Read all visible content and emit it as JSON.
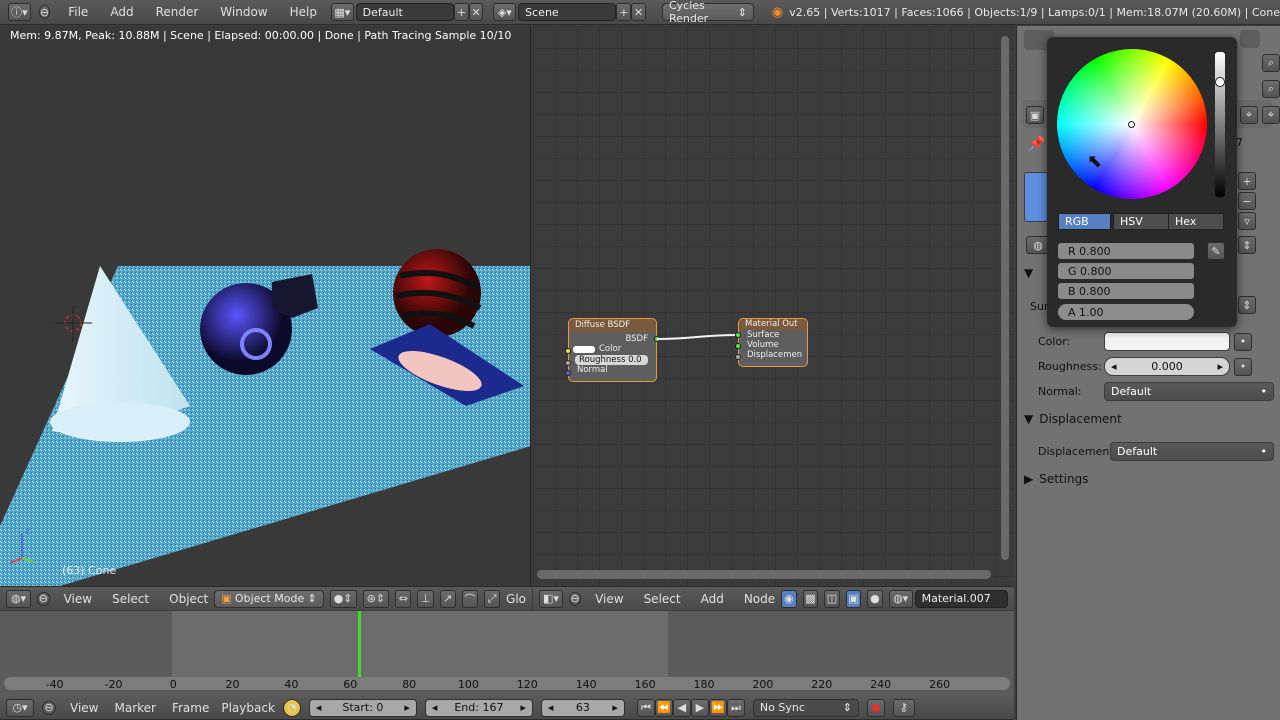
{
  "topbar": {
    "menus": [
      "File",
      "Add",
      "Render",
      "Window",
      "Help"
    ],
    "layout": "Default",
    "scene": "Scene",
    "engine": "Cycles Render",
    "stats": "v2.65 | Verts:1017 | Faces:1066 | Objects:1/9 | Lamps:0/1 | Mem:18.07M (20.60M) | Cone"
  },
  "viewport": {
    "info": "Mem: 9.87M, Peak: 10.88M | Scene | Elapsed: 00:00.00 | Done | Path Tracing Sample 10/10",
    "object_label": "(63) Cone",
    "header": {
      "view": "View",
      "select": "Select",
      "object": "Object",
      "mode": "Object Mode",
      "global": "Glo"
    }
  },
  "node_editor": {
    "diffuse": {
      "title": "Diffuse BSDF",
      "out": "BSDF",
      "color": "Color",
      "roughness": "Roughness 0.0",
      "normal": "Normal"
    },
    "output": {
      "title": "Material Out",
      "surface": "Surface",
      "volume": "Volume",
      "displacement": "Displacemen"
    },
    "header": {
      "view": "View",
      "select": "Select",
      "add": "Add",
      "node": "Node",
      "material": "Material.007"
    }
  },
  "properties": {
    "surface_label": "Surf",
    "color_label": "Color:",
    "roughness_label": "Roughness:",
    "roughness_value": "0.000",
    "normal_label": "Normal:",
    "normal_value": "Default",
    "displacement_section": "Displacement",
    "displacement_label": "Displacement:",
    "displacement_value": "Default",
    "settings_section": "Settings",
    "partial_7": "7"
  },
  "picker": {
    "tabs": [
      "RGB",
      "HSV",
      "Hex"
    ],
    "active_tab": "RGB",
    "r": "R 0.800",
    "g": "G 0.800",
    "b": "B 0.800",
    "a": "A 1.00",
    "value_fraction": 0.8
  },
  "timeline": {
    "ticks": [
      "-40",
      "-20",
      "0",
      "20",
      "40",
      "60",
      "80",
      "100",
      "120",
      "140",
      "160",
      "180",
      "200",
      "220",
      "240",
      "260"
    ],
    "current_frame": 63
  },
  "bottombar": {
    "view": "View",
    "marker": "Marker",
    "frame": "Frame",
    "playback": "Playback",
    "start": "Start: 0",
    "end": "End: 167",
    "frame_value": "63",
    "sync": "No Sync"
  },
  "colors": {
    "accent_blue": "#5680c2",
    "node_border": "#e79b38",
    "playhead": "#3fdc28"
  }
}
